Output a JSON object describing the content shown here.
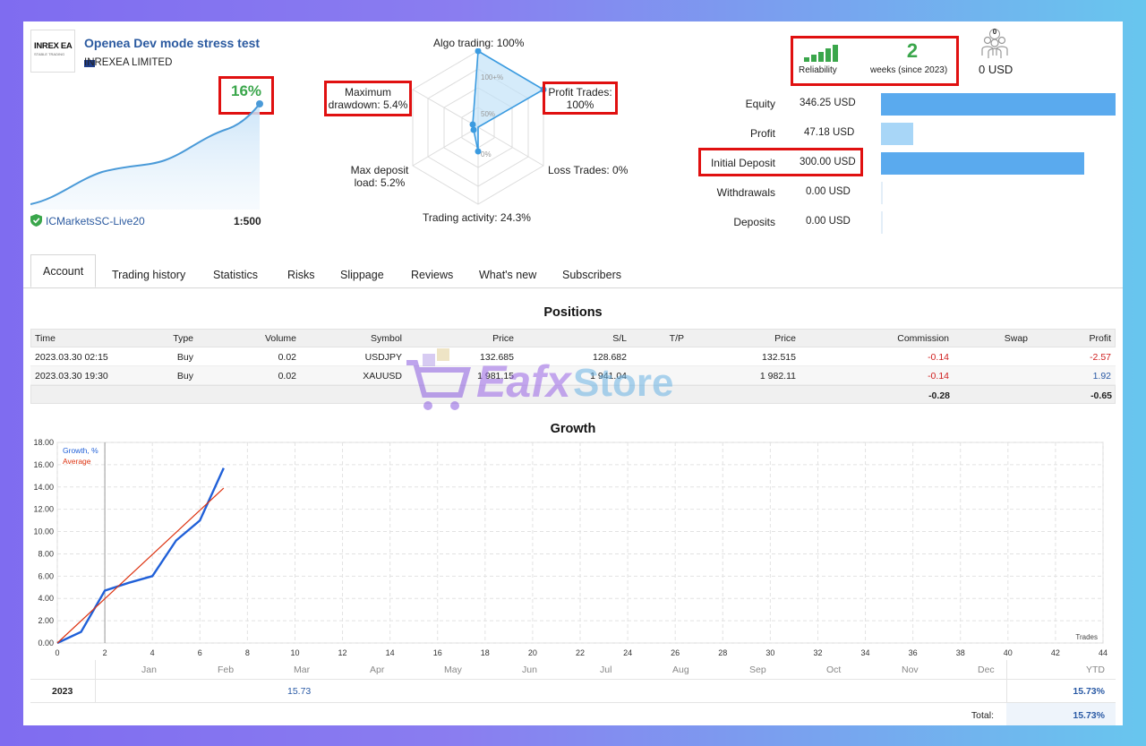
{
  "header": {
    "logo_text": "INREX EA",
    "logo_sub": "STABLE TRADING",
    "title": "Openea Dev mode stress test",
    "company": "INREXEA LIMITED",
    "growth_badge": "16%",
    "broker": "ICMarketsSC-Live20",
    "leverage": "1:500"
  },
  "radar": {
    "algo": "Algo trading: 100%",
    "profit_trades_1": "Profit Trades:",
    "profit_trades_2": "100%",
    "loss_trades": "Loss Trades: 0%",
    "trading_activity": "Trading activity: 24.3%",
    "max_deposit_1": "Max deposit",
    "max_deposit_2": "load: 5.2%",
    "max_dd_1": "Maximum",
    "max_dd_2": "drawdown: 5.4%",
    "ring_100": "100+%",
    "ring_50": "50%",
    "ring_0": "0%"
  },
  "stats": {
    "reliability_label": "Reliability",
    "weeks_value": "2",
    "weeks_label": "weeks (since 2023)",
    "subscribers_count": "0",
    "subscribers_usd": "0 USD",
    "rows": [
      {
        "label": "Equity",
        "value": "346.25 USD",
        "fraction": 1.0
      },
      {
        "label": "Profit",
        "value": "47.18 USD",
        "fraction": 0.136
      },
      {
        "label": "Initial Deposit",
        "value": "300.00 USD",
        "fraction": 0.866
      },
      {
        "label": "Withdrawals",
        "value": "0.00 USD",
        "fraction": 0
      },
      {
        "label": "Deposits",
        "value": "0.00 USD",
        "fraction": 0
      }
    ],
    "bar_color_dark": "#5aaaee",
    "bar_color_light": "#a8d6f7"
  },
  "tabs": [
    "Account",
    "Trading history",
    "Statistics",
    "Risks",
    "Slippage",
    "Reviews",
    "What's new",
    "Subscribers"
  ],
  "positions": {
    "title": "Positions",
    "columns": [
      "Time",
      "Type",
      "Volume",
      "Symbol",
      "Price",
      "S/L",
      "T/P",
      "Price",
      "Commission",
      "Swap",
      "Profit"
    ],
    "rows": [
      [
        "2023.03.30 02:15",
        "Buy",
        "0.02",
        "USDJPY",
        "132.685",
        "128.682",
        "",
        "132.515",
        "-0.14",
        "",
        "-2.57"
      ],
      [
        "2023.03.30 19:30",
        "Buy",
        "0.02",
        "XAUUSD",
        "1 981.15",
        "1 941.04",
        "",
        "1 982.11",
        "-0.14",
        "",
        "1.92"
      ]
    ],
    "total_commission": "-0.28",
    "total_profit": "-0.65"
  },
  "watermark": {
    "brand_a": "Eafx",
    "brand_b": "Store"
  },
  "growth": {
    "title": "Growth",
    "months": [
      "Jan",
      "Feb",
      "Mar",
      "Apr",
      "May",
      "Jun",
      "Jul",
      "Aug",
      "Sep",
      "Oct",
      "Nov",
      "Dec",
      "YTD"
    ],
    "year": "2023",
    "feb_value": "15.73",
    "ytd_value": "15.73%",
    "total_label": "Total:",
    "total_value": "15.73%"
  },
  "chart_data": {
    "type": "line",
    "title": "Growth",
    "xlabel": "Trades",
    "ylabel": "",
    "xlim": [
      0,
      44
    ],
    "ylim": [
      0,
      18
    ],
    "x_ticks": [
      0,
      2,
      4,
      6,
      8,
      10,
      12,
      14,
      16,
      18,
      20,
      22,
      24,
      26,
      28,
      30,
      32,
      34,
      36,
      38,
      40,
      42,
      44
    ],
    "y_ticks": [
      "0.00",
      "2.00",
      "4.00",
      "6.00",
      "8.00",
      "10.00",
      "12.00",
      "14.00",
      "16.00",
      "18.00"
    ],
    "grid": true,
    "legend": "top-left",
    "series": [
      {
        "name": "Growth, %",
        "color": "#2060d8",
        "x": [
          0,
          1,
          2,
          3,
          4,
          5,
          6,
          7
        ],
        "y": [
          0,
          1.0,
          4.7,
          5.4,
          6.0,
          9.2,
          11.0,
          15.7
        ]
      },
      {
        "name": "Average",
        "color": "#dd3311",
        "x": [
          0,
          7
        ],
        "y": [
          0,
          13.9
        ]
      }
    ]
  }
}
